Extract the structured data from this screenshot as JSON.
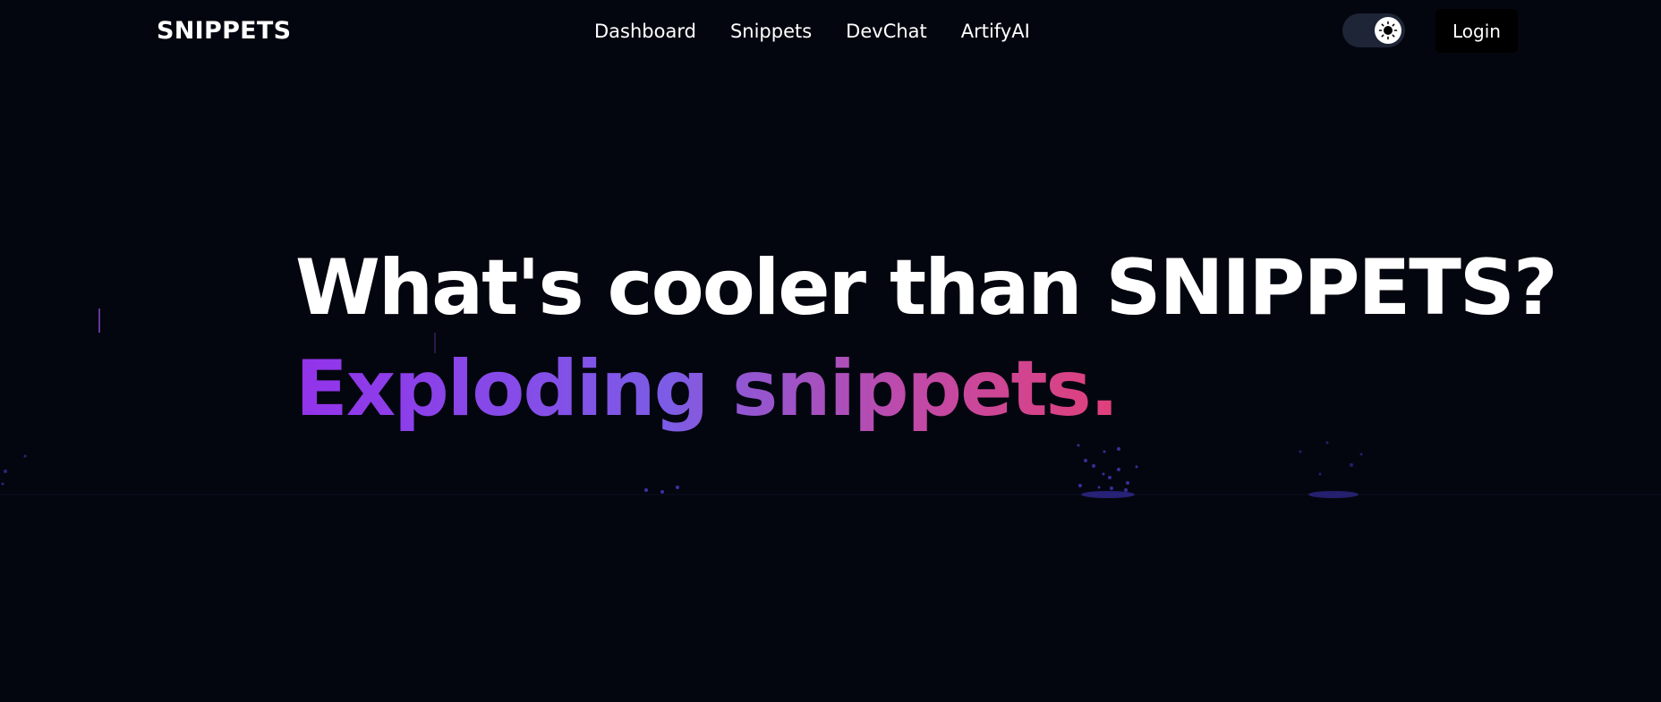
{
  "navbar": {
    "brand": "SNIPPETS",
    "links": [
      {
        "label": "Dashboard"
      },
      {
        "label": "Snippets"
      },
      {
        "label": "DevChat"
      },
      {
        "label": "ArtifyAI"
      }
    ],
    "theme_toggle_icon": "sun-icon",
    "login_label": "Login"
  },
  "hero": {
    "title_line1": "What's cooler than SNIPPETS?",
    "title_line2": "Exploding snippets."
  },
  "colors": {
    "background": "#04060f",
    "gradient_start": "#9333ea",
    "gradient_end": "#e0407a"
  }
}
